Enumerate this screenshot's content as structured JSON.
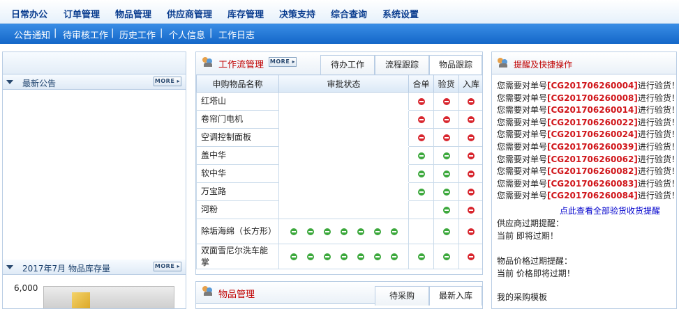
{
  "top_menu": [
    "日常办公",
    "订单管理",
    "物品管理",
    "供应商管理",
    "库存管理",
    "决策支持",
    "综合查询",
    "系统设置"
  ],
  "sub_menu": [
    "公告通知",
    "待审核工作",
    "历史工作",
    "个人信息",
    "工作日志"
  ],
  "sub_menu_separator": "|",
  "more_label": "MORE",
  "left": {
    "announcement_title": "最新公告",
    "inventory_title": "2017年7月 物品库存量",
    "inventory_axis_label": "6,000"
  },
  "workflow": {
    "title": "工作流管理",
    "tabs": [
      "待办工作",
      "流程跟踪",
      "物品跟踪"
    ],
    "columns": [
      "申购物品名称",
      "审批状态",
      "合单",
      "验货",
      "入库"
    ],
    "rows": [
      {
        "name": "红塔山",
        "approval": 0,
        "merge": "red",
        "inspect": "red",
        "stock": "red"
      },
      {
        "name": "卷帘门电机",
        "approval": 0,
        "merge": "red",
        "inspect": "red",
        "stock": "red"
      },
      {
        "name": "空调控制面板",
        "approval": 0,
        "merge": "red",
        "inspect": "red",
        "stock": "red"
      },
      {
        "name": "盖中华",
        "approval": 0,
        "merge": "green",
        "inspect": "green",
        "stock": "red"
      },
      {
        "name": "软中华",
        "approval": 0,
        "merge": "green",
        "inspect": "green",
        "stock": "red"
      },
      {
        "name": "万宝路",
        "approval": 0,
        "merge": "green",
        "inspect": "green",
        "stock": "red"
      },
      {
        "name": "河粉",
        "approval": 0,
        "merge": "",
        "inspect": "green",
        "stock": "red"
      },
      {
        "name": "除垢海绵（长方形）",
        "approval": 7,
        "merge": "",
        "inspect": "green",
        "stock": "red"
      },
      {
        "name": "双面雪尼尔洗车能掌",
        "approval": 7,
        "merge": "green",
        "inspect": "green",
        "stock": "red"
      }
    ]
  },
  "goods": {
    "title": "物品管理",
    "tabs": [
      "待采购",
      "最新入库"
    ]
  },
  "reminders": {
    "title": "提醒及快捷操作",
    "items": [
      {
        "prefix": "您需要对单号",
        "code": "[CG201706260004]",
        "suffix": "进行验货！"
      },
      {
        "prefix": "您需要对单号",
        "code": "[CG201706260008]",
        "suffix": "进行验货！"
      },
      {
        "prefix": "您需要对单号",
        "code": "[CG201706260014]",
        "suffix": "进行验货！"
      },
      {
        "prefix": "您需要对单号",
        "code": "[CG201706260022]",
        "suffix": "进行验货！"
      },
      {
        "prefix": "您需要对单号",
        "code": "[CG201706260024]",
        "suffix": "进行验货！"
      },
      {
        "prefix": "您需要对单号",
        "code": "[CG201706260039]",
        "suffix": "进行验货！"
      },
      {
        "prefix": "您需要对单号",
        "code": "[CG201706260062]",
        "suffix": "进行验货！"
      },
      {
        "prefix": "您需要对单号",
        "code": "[CG201706260082]",
        "suffix": "进行验货！"
      },
      {
        "prefix": "您需要对单号",
        "code": "[CG201706260083]",
        "suffix": "进行验货！"
      },
      {
        "prefix": "您需要对单号",
        "code": "[CG201706260084]",
        "suffix": "进行验货！"
      }
    ],
    "view_all_link": "点此查看全部验货收货提醒",
    "supplier_title": "供应商过期提醒：",
    "supplier_text": "当前 即将过期！",
    "price_title": "物品价格过期提醒：",
    "price_text": "当前 价格即将过期！",
    "template_title": "我的采购模板"
  },
  "colors": {
    "nav_text": "#0a3d8f",
    "subnav_bg": "#1467c9",
    "panel_title": "#c00000",
    "order_code": "#d0151a",
    "link": "#0000cc",
    "status_red": "#d8262e",
    "status_green": "#3ca83c"
  }
}
